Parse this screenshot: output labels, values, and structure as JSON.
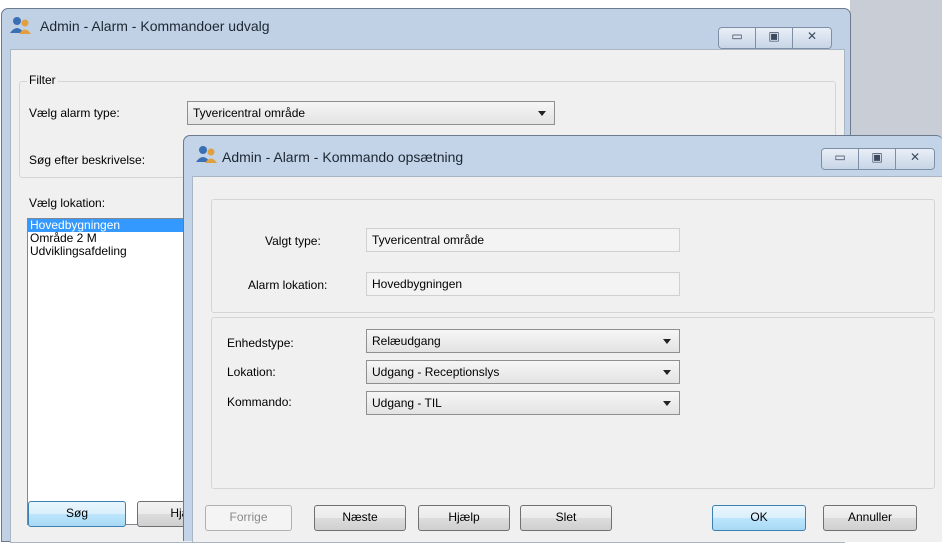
{
  "back_window": {
    "title": "Admin - Alarm - Kommandoer udvalg",
    "filter_legend": "Filter",
    "alarm_type_label": "Vælg alarm type:",
    "alarm_type_value": "Tyvericentral område",
    "search_label": "Søg efter beskrivelse:",
    "location_label": "Vælg lokation:",
    "locations": [
      "Hovedbygningen",
      "Område 2 M",
      "Udviklingsafdeling"
    ],
    "selected_location": "Hovedbygningen",
    "search_button": "Søg",
    "help_button": "Hjælp"
  },
  "front_window": {
    "title": "Admin - Alarm - Kommando opsætning",
    "selected_type_label": "Valgt type:",
    "selected_type_value": "Tyvericentral område",
    "alarm_location_label": "Alarm lokation:",
    "alarm_location_value": "Hovedbygningen",
    "unit_type_label": "Enhedstype:",
    "unit_type_value": "Relæudgang",
    "location_label": "Lokation:",
    "location_value": "Udgang - Receptionslys",
    "command_label": "Kommando:",
    "command_value": "Udgang - TIL",
    "buttons": {
      "previous": "Forrige",
      "next": "Næste",
      "help": "Hjælp",
      "delete": "Slet",
      "ok": "OK",
      "cancel": "Annuller"
    }
  },
  "icons": {
    "app": "users-icon",
    "minimize": "minimize-icon",
    "maximize": "maximize-icon",
    "close": "close-icon"
  },
  "colors": {
    "selection": "#3399ff",
    "window_frame": "#c0d1e6",
    "default_button": "#bee6fd"
  }
}
